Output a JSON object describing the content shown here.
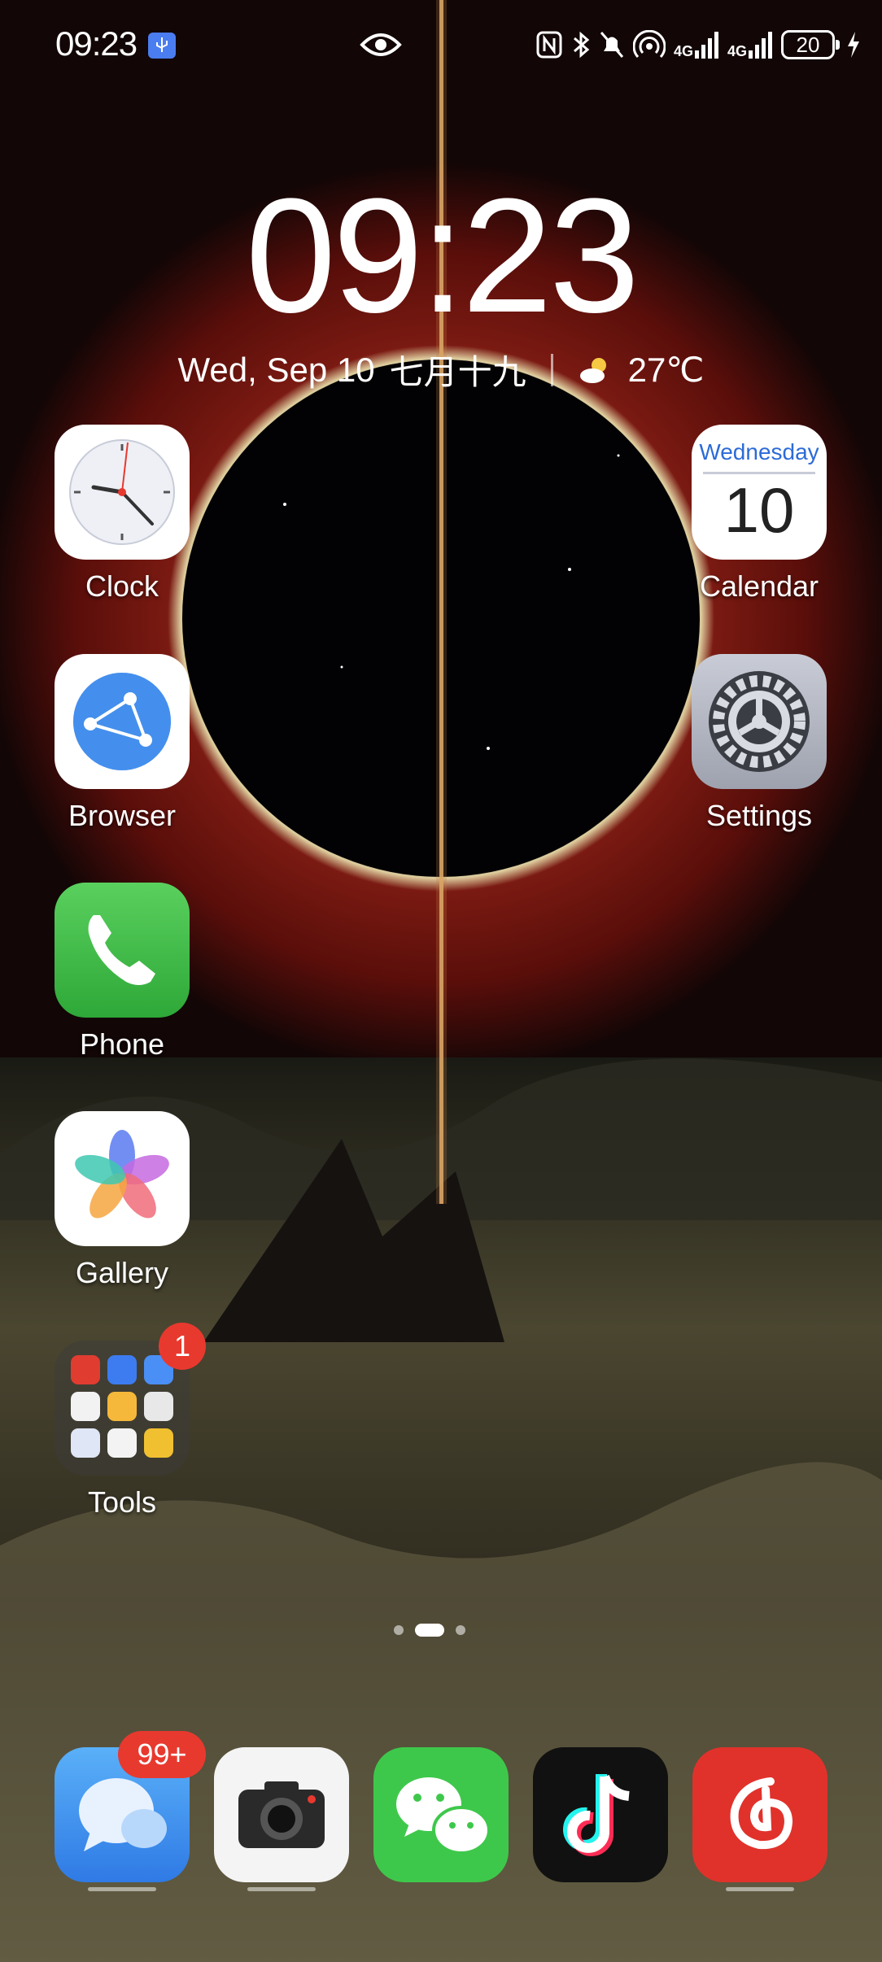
{
  "status_bar": {
    "time": "09:23",
    "network_1": "4G",
    "network_2": "4G",
    "battery": "20",
    "icons": [
      "usb-icon",
      "eye-icon",
      "nfc-icon",
      "bluetooth-icon",
      "mute-bell-icon",
      "hotspot-icon",
      "signal-icon",
      "signal-icon",
      "battery-icon",
      "charging-icon"
    ]
  },
  "clock_widget": {
    "time": "09:23",
    "date": "Wed, Sep 10",
    "lunar_date": "七月十九",
    "temperature": "27℃",
    "weather_icon": "partly-sunny-icon"
  },
  "apps": {
    "clock": "Clock",
    "calendar": "Calendar",
    "calendar_weekday": "Wednesday",
    "calendar_day": "10",
    "browser": "Browser",
    "settings": "Settings",
    "phone": "Phone",
    "gallery": "Gallery",
    "tools": "Tools",
    "tools_badge": "1"
  },
  "dock": {
    "messages_badge": "99+",
    "apps": [
      "messages-app",
      "camera-app",
      "wechat-app",
      "tiktok-app",
      "netease-music-app"
    ]
  },
  "page_indicator": {
    "pages": 3,
    "current": 2
  },
  "colors": {
    "phone_green": "#3fbd47",
    "wechat_green": "#3ec84b",
    "badge_red": "#e8392f",
    "netease_red": "#e0322b"
  }
}
